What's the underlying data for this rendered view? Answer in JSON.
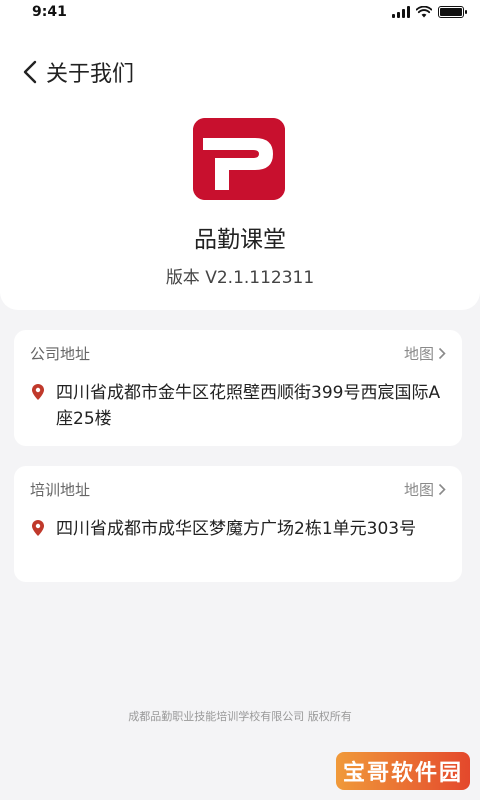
{
  "status_bar": {
    "time": "9:41"
  },
  "header": {
    "title": "关于我们",
    "app_name": "品勤课堂",
    "version": "版本 V2.1.112311"
  },
  "company_address": {
    "label": "公司地址",
    "map_label": "地图",
    "address": "四川省成都市金牛区花照壁西顺街399号西宸国际A座25楼"
  },
  "training_address": {
    "label": "培训地址",
    "map_label": "地图",
    "address": "四川省成都市成华区梦魔方广场2栋1单元303号"
  },
  "footer": {
    "copyright": "成都品勤职业技能培训学校有限公司 版权所有"
  },
  "watermark": {
    "text": "宝哥软件园"
  },
  "colors": {
    "brand_red": "#c8102e",
    "pin_red": "#c0392b",
    "background": "#f4f4f6"
  },
  "icons": [
    "back-arrow-icon",
    "app-logo-icon",
    "location-pin-icon",
    "chevron-right-icon",
    "signal-icon",
    "wifi-icon",
    "battery-icon"
  ]
}
